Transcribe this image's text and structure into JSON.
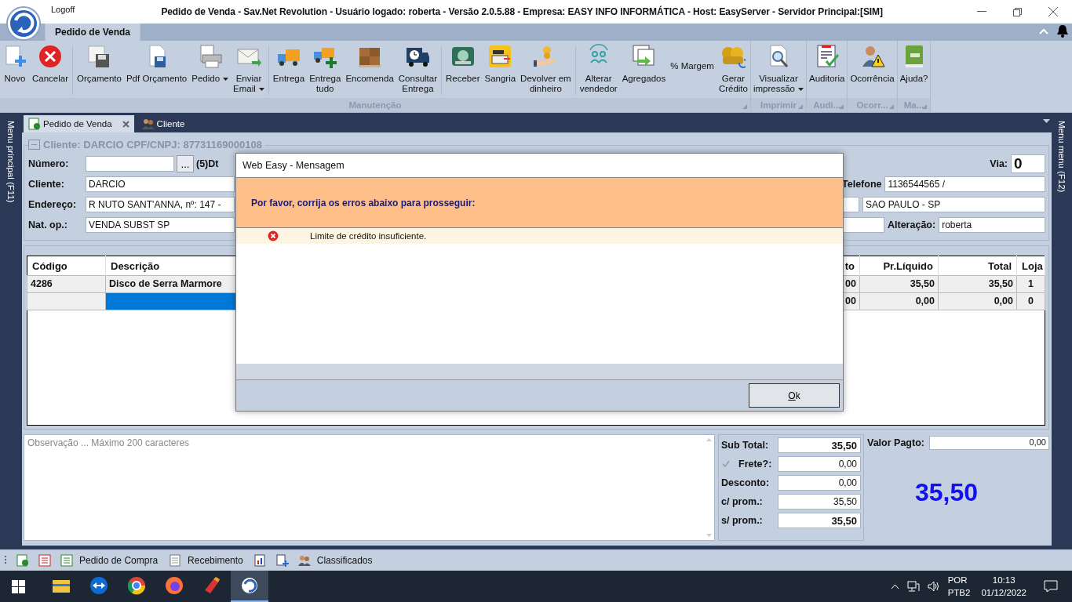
{
  "title_bar": {
    "logoff": "Logoff",
    "title": "Pedido de Venda - Sav.Net Revolution - Usuário logado: roberta - Versão 2.0.5.88 - Empresa: EASY INFO INFORMÁTICA - Host: EasyServer - Servidor Principal:[SIM]"
  },
  "ribbon": {
    "tabs": [
      {
        "label": "Pedido de Venda",
        "selected": true
      }
    ],
    "groups": [
      {
        "label": "Manutenção",
        "sections": [
          [
            {
              "label": "Novo",
              "dropdown": false
            },
            {
              "label": "Cancelar",
              "dropdown": false
            }
          ],
          [
            {
              "label": "Orçamento",
              "dropdown": false
            },
            {
              "label": "Pdf Orçamento",
              "dropdown": false
            },
            {
              "label": "Pedido",
              "dropdown": true
            },
            {
              "label": "Enviar\nEmail",
              "dropdown": true
            }
          ],
          [
            {
              "label": "Entrega",
              "dropdown": false
            },
            {
              "label": "Entrega\ntudo",
              "dropdown": false
            },
            {
              "label": "Encomenda",
              "dropdown": false
            },
            {
              "label": "Consultar\nEntrega",
              "dropdown": false
            }
          ],
          [
            {
              "label": "Receber",
              "dropdown": false
            },
            {
              "label": "Sangria",
              "dropdown": false
            },
            {
              "label": "Devolver em\ndinheiro",
              "dropdown": false
            }
          ],
          [
            {
              "label": "Alterar\nvendedor",
              "dropdown": false
            },
            {
              "label": "Agregados",
              "dropdown": false
            },
            {
              "label": "% Margem",
              "dropdown": false
            },
            {
              "label": "Gerar\nCrédito",
              "dropdown": false
            }
          ]
        ]
      },
      {
        "label": "Imprimir",
        "sections": [
          [
            {
              "label": "Visualizar\nimpressão",
              "dropdown": true
            }
          ]
        ]
      },
      {
        "label": "Audi...",
        "sections": [
          [
            {
              "label": "Auditoria",
              "dropdown": false
            }
          ]
        ]
      },
      {
        "label": "Ocorr...",
        "sections": [
          [
            {
              "label": "Ocorrência",
              "dropdown": false
            }
          ]
        ]
      },
      {
        "label": "Ma...",
        "sections": [
          [
            {
              "label": "Ajuda?",
              "dropdown": false
            }
          ]
        ]
      }
    ]
  },
  "left_sidebar": "Menu principal (F11)",
  "right_sidebar": "Menu menu (F12)",
  "doc_tabs": [
    {
      "label": "Pedido de Venda",
      "selected": true
    },
    {
      "label": "Cliente",
      "selected": false
    }
  ],
  "form": {
    "title": "Cliente: DARCIO CPF/CNPJ: 87731169000108",
    "numero_label": "Número:",
    "lookup_button": "...",
    "dt_label": "(5)Dt",
    "via_label": "Via:",
    "via_value": "0",
    "rows": [
      {
        "label": "Cliente:",
        "value": "DARCIO"
      },
      {
        "label": "Endereço:",
        "value": "R NUTO SANT'ANNA, nº: 147 -"
      },
      {
        "label": "Nat. op.:",
        "value": "VENDA SUBST SP"
      }
    ],
    "telefone_label": "Telefone",
    "telefone_value": "1136544565 /",
    "cidade_value": "SAO PAULO - SP",
    "alteracao_label": "Alteração:",
    "alteracao_value": "roberta"
  },
  "table": {
    "columns": [
      "Código",
      "Descrição",
      "to",
      "Pr.Líquido",
      "Total",
      "Loja"
    ],
    "rows": [
      {
        "cells": [
          "4286",
          "Disco de Serra Marmore",
          "00",
          "35,50",
          "35,50",
          "1"
        ],
        "selected": false
      },
      {
        "cells": [
          "",
          "",
          "00",
          "0,00",
          "0,00",
          "0"
        ],
        "selected": true
      }
    ]
  },
  "observation": {
    "placeholder": "Observação ... Máximo 200 caracteres"
  },
  "totals": {
    "sub_total_label": "Sub Total:",
    "sub_total": "35,50",
    "frete_label": "Frete?:",
    "frete_checked": true,
    "frete": "0,00",
    "desconto_label": "Desconto:",
    "desconto": "0,00",
    "c_prom_label": "c/ prom.:",
    "c_prom": "35,50",
    "s_prom_label": "s/ prom.:",
    "s_prom": "35,50",
    "valor_pagto_label": "Valor Pagto:",
    "valor_pagto": "0,00",
    "grand_total": "35,50"
  },
  "dialog": {
    "title": "Web Easy - Mensagem",
    "header": "Por favor, corrija os erros abaixo para prosseguir:",
    "errors": [
      "Limite de crédito insuficiente."
    ],
    "ok_button": "Ok"
  },
  "bottom_bar": [
    "Pedido de Compra",
    "Recebimento",
    "Classificados"
  ],
  "taskbar": {
    "apps": [
      {
        "selected": false
      },
      {
        "selected": false
      },
      {
        "selected": false
      },
      {
        "selected": false
      },
      {
        "selected": false
      },
      {
        "selected": true
      }
    ],
    "language": "POR",
    "keyboard": "PTB2",
    "time": "10:13",
    "date": "01/12/2022"
  }
}
